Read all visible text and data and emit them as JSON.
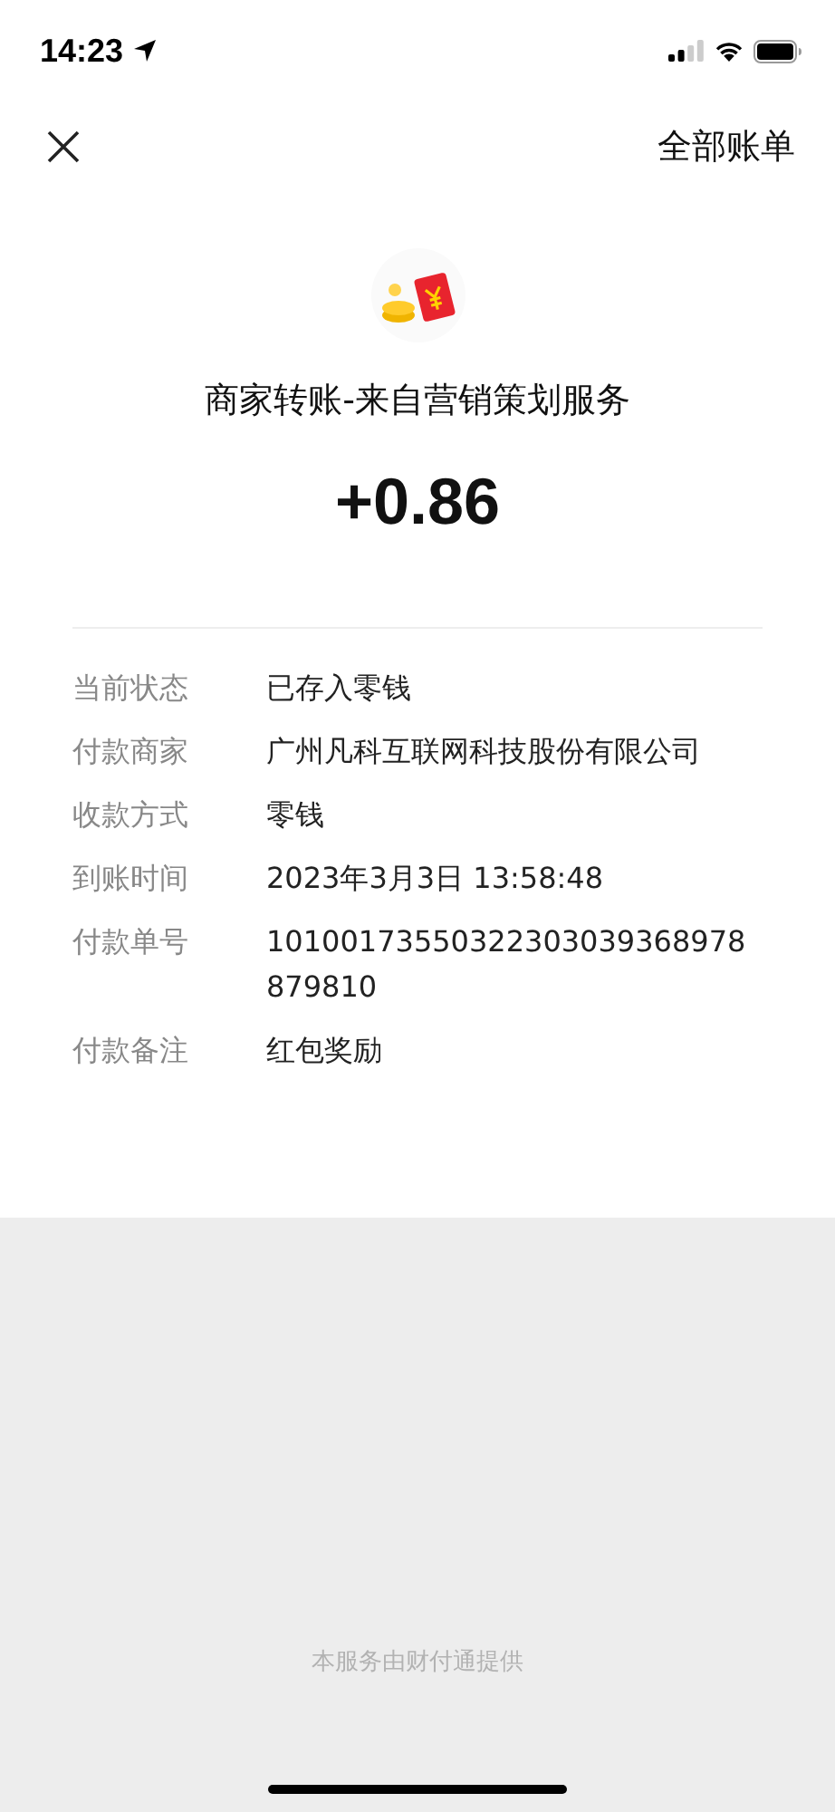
{
  "status_bar": {
    "time": "14:23"
  },
  "nav": {
    "right_link": "全部账单"
  },
  "title": "商家转账-来自营销策划服务",
  "amount": "+0.86",
  "details": [
    {
      "label": "当前状态",
      "value": "已存入零钱"
    },
    {
      "label": "付款商家",
      "value": "广州凡科互联网科技股份有限公司"
    },
    {
      "label": "收款方式",
      "value": "零钱"
    },
    {
      "label": "到账时间",
      "value": "2023年3月3日 13:58:48"
    },
    {
      "label": "付款单号",
      "value": "10100173550322303039368978879810"
    },
    {
      "label": "付款备注",
      "value": "红包奖励"
    }
  ],
  "footer": "本服务由财付通提供"
}
